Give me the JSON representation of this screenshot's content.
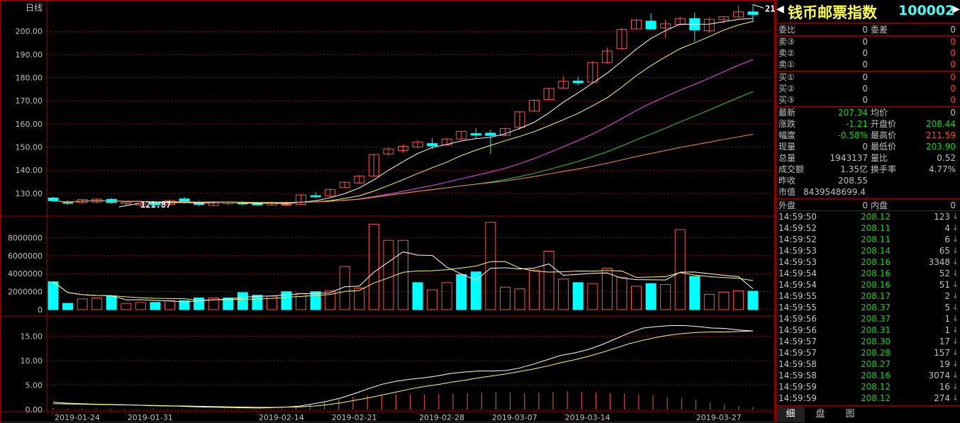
{
  "chart_title": "日线",
  "header": {
    "nav_left": "◀",
    "nav_right": "▶",
    "name": "钱币邮票指数",
    "code": "100002"
  },
  "price_panel": {
    "y_ticks": [
      "200.00",
      "190.00",
      "180.00",
      "170.00",
      "160.00",
      "150.00",
      "140.00",
      "130.00"
    ],
    "high_label": "211.59",
    "low_label": "121.87"
  },
  "volume_panel": {
    "y_ticks": [
      "8000000",
      "6000000",
      "4000000",
      "2000000",
      "0"
    ]
  },
  "indicator_panel": {
    "y_ticks": [
      "15.00",
      "10.00",
      "5.00",
      "0.00"
    ]
  },
  "x_dates": [
    "2019-01-24",
    "2019-01-31",
    "2019-02-14",
    "2019-02-21",
    "2019-02-28",
    "2019-03-07",
    "2019-03-14",
    "2019-03-27"
  ],
  "colors": {
    "up": "#ff5050",
    "down": "#00ffff",
    "grid": "#a00000",
    "ma5": "#ffffff",
    "ma10": "#ffff40",
    "ma20": "#ff40ff",
    "ma30": "#30d030",
    "ma60": "#ff9030",
    "positive": "#ff4040",
    "negative": "#00e000",
    "neutral": "#c0c0c0"
  },
  "chart_data": {
    "type": "candlestick",
    "ohlc": [
      [
        128.0,
        128.6,
        126.2,
        126.8
      ],
      [
        126.0,
        127.0,
        125.0,
        125.8
      ],
      [
        126.0,
        127.5,
        125.6,
        127.3
      ],
      [
        126.2,
        127.8,
        125.8,
        127.5
      ],
      [
        127.4,
        128.0,
        125.5,
        126.0
      ],
      [
        125.5,
        126.5,
        124.8,
        126.2
      ],
      [
        125.0,
        126.0,
        124.2,
        125.6
      ],
      [
        126.3,
        126.8,
        124.5,
        125.0
      ],
      [
        125.2,
        127.2,
        124.9,
        126.9
      ],
      [
        127.6,
        128.4,
        125.8,
        126.4
      ],
      [
        126.0,
        126.8,
        124.6,
        125.2
      ],
      [
        124.8,
        126.6,
        124.4,
        126.3
      ],
      [
        125.5,
        126.5,
        124.8,
        126.2
      ],
      [
        126.0,
        126.6,
        124.8,
        125.4
      ],
      [
        125.8,
        126.3,
        124.6,
        125.0
      ],
      [
        125.0,
        126.4,
        124.6,
        125.9
      ],
      [
        125.0,
        126.5,
        124.5,
        125.2
      ],
      [
        125.2,
        129.5,
        125.0,
        129.3
      ],
      [
        129.0,
        130.5,
        127.9,
        128.5
      ],
      [
        128.8,
        132.2,
        128.3,
        131.6
      ],
      [
        132.5,
        135.0,
        132.2,
        134.8
      ],
      [
        134.5,
        137.8,
        134.2,
        137.5
      ],
      [
        137.5,
        147.0,
        137.3,
        146.8
      ],
      [
        147.0,
        150.0,
        146.3,
        149.2
      ],
      [
        148.5,
        151.0,
        147.6,
        150.3
      ],
      [
        150.0,
        153.0,
        149.5,
        152.2
      ],
      [
        151.5,
        154.0,
        149.0,
        150.5
      ],
      [
        151.0,
        154.0,
        150.5,
        153.5
      ],
      [
        153.5,
        157.0,
        153.3,
        156.8
      ],
      [
        155.8,
        158.2,
        153.5,
        155.2
      ],
      [
        156.0,
        157.5,
        147.0,
        155.0
      ],
      [
        155.0,
        158.3,
        154.7,
        158.0
      ],
      [
        158.5,
        165.6,
        157.5,
        165.2
      ],
      [
        165.5,
        170.4,
        165.2,
        170.2
      ],
      [
        170.5,
        175.5,
        170.3,
        175.3
      ],
      [
        175.5,
        180.5,
        175.2,
        178.4
      ],
      [
        178.5,
        180.5,
        176.5,
        177.8
      ],
      [
        178.0,
        187.0,
        177.8,
        186.5
      ],
      [
        186.5,
        193.0,
        186.0,
        191.5
      ],
      [
        192.5,
        201.5,
        192.0,
        200.8
      ],
      [
        201.0,
        205.3,
        200.8,
        204.9
      ],
      [
        204.4,
        207.8,
        200.5,
        201.0
      ],
      [
        201.5,
        205.0,
        197.0,
        203.2
      ],
      [
        203.0,
        206.3,
        202.5,
        205.5
      ],
      [
        205.5,
        208.0,
        195.5,
        200.6
      ],
      [
        200.2,
        206.0,
        199.5,
        205.2
      ],
      [
        205.0,
        206.5,
        203.5,
        206.3
      ],
      [
        206.2,
        211.0,
        205.8,
        208.4
      ],
      [
        208.4,
        211.59,
        203.9,
        207.3
      ]
    ],
    "volume": [
      3100000,
      700000,
      1200000,
      1300000,
      1500000,
      700000,
      800000,
      800000,
      1000000,
      1000000,
      1300000,
      1300000,
      1300000,
      1900000,
      1600000,
      1500000,
      2000000,
      1800000,
      2000000,
      2100000,
      4800000,
      2400000,
      9500000,
      7700000,
      7700000,
      3000000,
      2200000,
      3000000,
      3900000,
      4200000,
      9700000,
      2500000,
      2300000,
      4400000,
      6500000,
      3400000,
      3000000,
      2900000,
      4600000,
      3600000,
      2600000,
      2900000,
      2800000,
      8900000,
      3700000,
      1700000,
      1950000,
      2100000,
      2050000
    ],
    "volume_up_flags": [
      0,
      0,
      1,
      1,
      0,
      1,
      1,
      0,
      1,
      0,
      0,
      1,
      0,
      0,
      0,
      1,
      0,
      1,
      0,
      1,
      1,
      1,
      1,
      1,
      1,
      0,
      1,
      1,
      0,
      0,
      1,
      1,
      1,
      1,
      1,
      1,
      0,
      1,
      1,
      1,
      1,
      0,
      1,
      1,
      0,
      1,
      1,
      1,
      0
    ],
    "ylim_price": [
      122,
      212
    ],
    "ylim_volume": [
      0,
      10000000
    ],
    "ylim_indicator": [
      0,
      18
    ],
    "indicator_main": [
      1.5,
      1.3,
      1.2,
      1.1,
      1.05,
      1.0,
      0.9,
      0.8,
      0.75,
      0.7,
      0.6,
      0.5,
      0.45,
      0.4,
      0.35,
      0.3,
      0.4,
      0.5,
      0.7,
      1.2,
      1.7,
      2.4,
      3.3,
      4.3,
      5.2,
      5.8,
      6.2,
      6.5,
      6.9,
      7.4,
      7.7,
      7.9,
      7.9,
      8.0,
      8.5,
      9.3,
      10.2,
      11.1,
      11.6,
      12.3,
      13.3,
      14.5,
      15.7,
      16.7,
      17.0,
      17.2,
      17.2,
      17.0,
      16.7,
      16.6,
      16.3,
      16.1
    ],
    "indicator_signal": [
      1.2,
      1.15,
      1.1,
      1.05,
      1.0,
      0.95,
      0.9,
      0.85,
      0.8,
      0.75,
      0.7,
      0.65,
      0.6,
      0.55,
      0.5,
      0.45,
      0.45,
      0.5,
      0.55,
      0.7,
      1.0,
      1.4,
      1.9,
      2.4,
      3.0,
      3.6,
      4.2,
      4.7,
      5.1,
      5.6,
      6.0,
      6.5,
      6.9,
      7.3,
      7.8,
      8.3,
      8.9,
      9.6,
      10.2,
      10.9,
      11.7,
      12.6,
      13.5,
      14.2,
      14.8,
      15.3,
      15.6,
      15.8,
      15.9,
      15.9,
      16.0,
      16.1
    ],
    "indicator_bars": [
      0.3,
      0.2,
      0.2,
      0.2,
      0.2,
      0.15,
      0.15,
      0.15,
      0.1,
      0.1,
      0.1,
      0.1,
      0.1,
      0.1,
      0.1,
      0.1,
      0.2,
      0.5,
      1.0,
      1.6,
      2.2,
      2.6,
      2.9,
      3.0,
      3.1,
      3.1,
      3.1,
      3.2,
      3.3,
      3.4,
      3.5,
      3.5,
      3.5,
      3.4,
      3.5,
      3.6,
      3.7,
      3.6,
      3.5,
      3.4,
      3.3,
      3.1,
      2.9,
      2.6,
      2.3,
      2.0,
      1.5,
      1.0,
      0.7,
      0.5
    ]
  },
  "quote": {
    "rows_a": [
      {
        "label": "委比",
        "value": "0",
        "label2": "委差",
        "value2": "0"
      }
    ],
    "sell": [
      {
        "label": "卖③",
        "price": "0",
        "vol": "0"
      },
      {
        "label": "卖②",
        "price": "0",
        "vol": "0"
      },
      {
        "label": "卖①",
        "price": "0",
        "vol": "0"
      }
    ],
    "buy": [
      {
        "label": "买①",
        "price": "0",
        "vol": "0"
      },
      {
        "label": "买②",
        "price": "0",
        "vol": "0"
      },
      {
        "label": "买③",
        "price": "0",
        "vol": "0"
      }
    ],
    "stats": [
      {
        "label": "最新",
        "value": "207.34",
        "vcolor": "#00e000",
        "label2": "均价",
        "value2": "0",
        "v2color": "#c0c0c0"
      },
      {
        "label": "涨跌",
        "value": "-1.21",
        "vcolor": "#00e000",
        "label2": "开盘价",
        "value2": "208.44",
        "v2color": "#00e000"
      },
      {
        "label": "幅度",
        "value": "-0.58%",
        "vcolor": "#00e000",
        "label2": "最高价",
        "value2": "211.59",
        "v2color": "#ff4040"
      },
      {
        "label": "现量",
        "value": "0",
        "vcolor": "#c0c0c0",
        "label2": "最低价",
        "value2": "203.90",
        "v2color": "#00e000"
      },
      {
        "label": "总量",
        "value": "1943137",
        "vcolor": "#c0c0c0",
        "label2": "量比",
        "value2": "0.52",
        "v2color": "#c0c0c0"
      },
      {
        "label": "成交额",
        "value": "1.35亿",
        "vcolor": "#c0c0c0",
        "label2": "换手率",
        "value2": "4.77%",
        "v2color": "#c0c0c0"
      },
      {
        "label": "昨收",
        "value": "208.55",
        "vcolor": "#c0c0c0",
        "label2": "",
        "value2": "",
        "v2color": "#c0c0c0"
      },
      {
        "label": "市值",
        "value": "8439548699.4",
        "vcolor": "#c0c0c0",
        "label2": "",
        "value2": "",
        "v2color": "#c0c0c0"
      }
    ],
    "outer_inner": {
      "label": "外盘",
      "value": "0",
      "label2": "内盘",
      "value2": "0"
    }
  },
  "ticks": [
    {
      "time": "14:59:50",
      "price": "208.12",
      "vol": "123",
      "arrow": "↓"
    },
    {
      "time": "14:59:52",
      "price": "208.11",
      "vol": "4",
      "arrow": "↓"
    },
    {
      "time": "14:59:52",
      "price": "208.11",
      "vol": "6",
      "arrow": "↓"
    },
    {
      "time": "14:59:53",
      "price": "208.14",
      "vol": "65",
      "arrow": "↓"
    },
    {
      "time": "14:59:53",
      "price": "208.16",
      "vol": "3348",
      "arrow": "↓"
    },
    {
      "time": "14:59:54",
      "price": "208.16",
      "vol": "52",
      "arrow": "↓"
    },
    {
      "time": "14:59:54",
      "price": "208.16",
      "vol": "51",
      "arrow": "↓"
    },
    {
      "time": "14:59:55",
      "price": "208.17",
      "vol": "2",
      "arrow": "↓"
    },
    {
      "time": "14:59:55",
      "price": "208.37",
      "vol": "5",
      "arrow": "↓"
    },
    {
      "time": "14:59:56",
      "price": "208.37",
      "vol": "1",
      "arrow": "↓"
    },
    {
      "time": "14:59:56",
      "price": "208.31",
      "vol": "1",
      "arrow": "↓"
    },
    {
      "time": "14:59:57",
      "price": "208.30",
      "vol": "17",
      "arrow": "↓"
    },
    {
      "time": "14:59:57",
      "price": "208.28",
      "vol": "157",
      "arrow": "↓"
    },
    {
      "time": "14:59:58",
      "price": "208.27",
      "vol": "19",
      "arrow": "↓"
    },
    {
      "time": "14:59:58",
      "price": "208.16",
      "vol": "3074",
      "arrow": "↓"
    },
    {
      "time": "14:59:59",
      "price": "208.12",
      "vol": "16",
      "arrow": "↓"
    },
    {
      "time": "14:59:59",
      "price": "208.12",
      "vol": "274",
      "arrow": "↓"
    }
  ],
  "tabs": [
    {
      "label": "细",
      "active": true
    },
    {
      "label": "盘",
      "active": false
    },
    {
      "label": "图",
      "active": false
    }
  ]
}
